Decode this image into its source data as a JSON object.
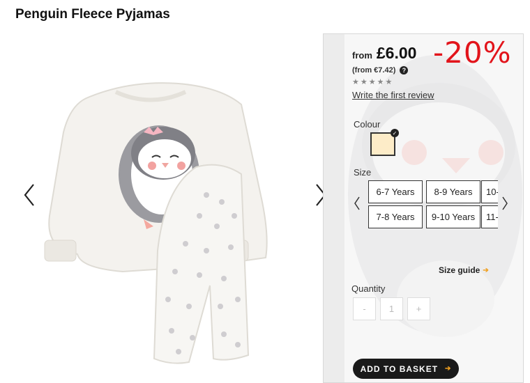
{
  "product": {
    "title": "Penguin Fleece Pyjamas"
  },
  "gallery": {
    "prev_icon": "chevron-left-icon",
    "next_icon": "chevron-right-icon"
  },
  "price": {
    "from_label": "from",
    "value": "£6.00",
    "euro": "(from €7.42)",
    "discount": "-20%",
    "help_icon": "question-icon",
    "stars": "★★★★★",
    "review_link": "Write the first review"
  },
  "colour": {
    "label": "Colour",
    "selected_swatch_color": "#fdecc8"
  },
  "size": {
    "label": "Size",
    "options": [
      "6-7 Years",
      "8-9 Years",
      "10-",
      "7-8 Years",
      "9-10 Years",
      "11-"
    ],
    "guide_label": "Size guide"
  },
  "quantity": {
    "label": "Quantity",
    "minus": "-",
    "value": "1",
    "plus": "+"
  },
  "basket": {
    "label": "ADD TO BASKET"
  },
  "colors": {
    "discount": "#e2141b",
    "accent": "#f0a020",
    "button": "#1a1a1a"
  }
}
